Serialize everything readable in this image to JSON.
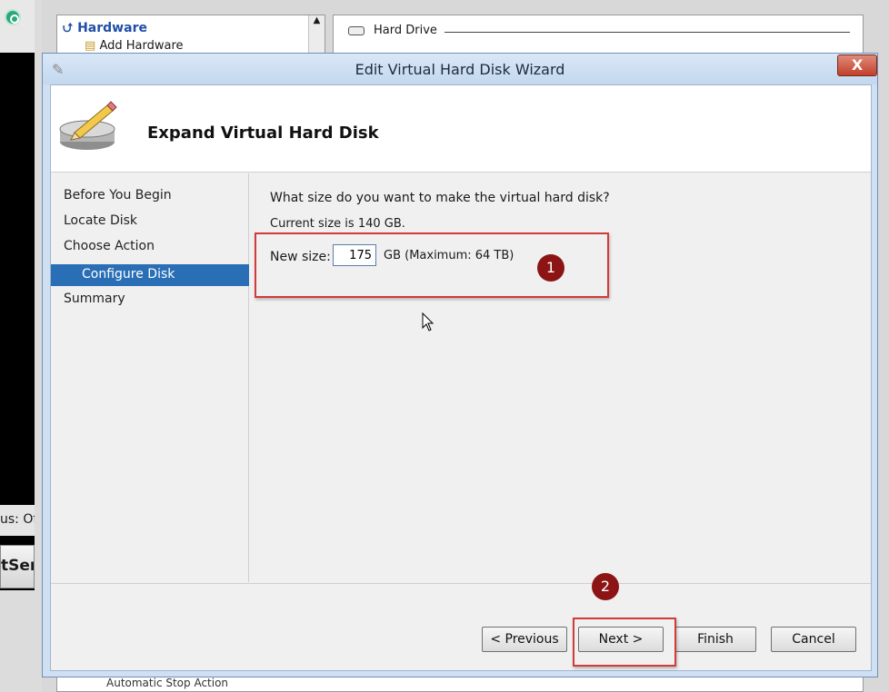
{
  "background": {
    "tree_header": "Hardware",
    "tree_item": "Add Hardware",
    "hard_drive_label": "Hard Drive",
    "left_status_fragment": "us: Off",
    "left_button_fragment": "tSer",
    "bottom_item": "Automatic Stop Action"
  },
  "dialog": {
    "title": "Edit Virtual Hard Disk Wizard",
    "close_label": "X",
    "header_title": "Expand Virtual Hard Disk"
  },
  "steps": [
    "Before You Begin",
    "Locate Disk",
    "Choose Action",
    "Configure Disk",
    "Summary"
  ],
  "active_step_index": 3,
  "form": {
    "question": "What size do you want to make the virtual hard disk?",
    "current_size": "Current size is 140 GB.",
    "new_size_label": "New size:",
    "new_size_value": "175",
    "unit_text": "GB (Maximum: 64 TB)"
  },
  "buttons": {
    "previous": "< Previous",
    "next": "Next >",
    "finish": "Finish",
    "cancel": "Cancel"
  },
  "annotations": {
    "badge_1": "1",
    "badge_2": "2",
    "color": "#8c1414",
    "box_color": "#d23b3b"
  },
  "colors": {
    "selected_step": "#2a6fb6",
    "close_button": "#c2402a",
    "tree_header": "#1f4fa8"
  }
}
